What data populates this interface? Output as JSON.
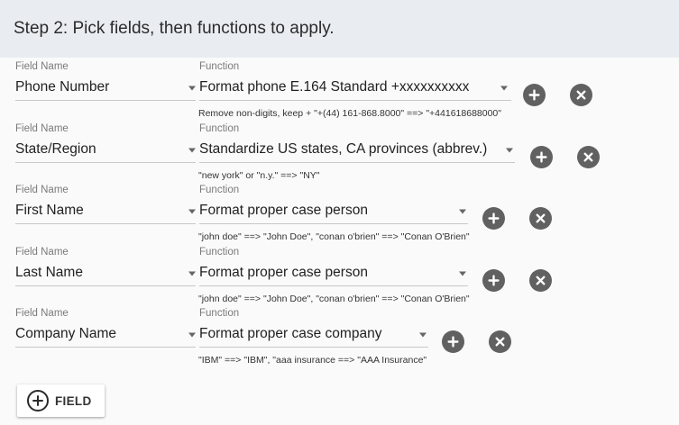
{
  "header": {
    "title": "Step 2: Pick fields, then functions to apply."
  },
  "labels": {
    "field_name": "Field Name",
    "function": "Function"
  },
  "rows": [
    {
      "field": "Phone Number",
      "function": "Format phone E.164 Standard +xxxxxxxxxx",
      "hint": "Remove non-digits, keep + \"+(44) 161-868.8000\" ==> \"+441618688000\""
    },
    {
      "field": "State/Region",
      "function": "Standardize US states, CA provinces (abbrev.)",
      "hint": "\"new york\" or \"n.y.\" ==> \"NY\""
    },
    {
      "field": "First Name",
      "function": "Format proper case person",
      "hint": "\"john doe\" ==> \"John Doe\", \"conan o'brien\" ==> \"Conan O'Brien\""
    },
    {
      "field": "Last Name",
      "function": "Format proper case person",
      "hint": "\"john doe\" ==> \"John Doe\", \"conan o'brien\" ==> \"Conan O'Brien\""
    },
    {
      "field": "Company Name",
      "function": "Format proper case company",
      "hint": "\"IBM\" ==> \"IBM\", \"aaa insurance ==> \"AAA Insurance\""
    }
  ],
  "icons": {
    "add": "plus-circle-icon",
    "remove": "close-circle-icon",
    "add_field": "plus-circle-outline-icon",
    "dropdown": "caret-down-icon"
  },
  "add_field_button": {
    "label": "FIELD"
  },
  "colors": {
    "header_bg": "#e9edf1",
    "page_bg": "#fafafa",
    "icon_button": "#616161"
  }
}
